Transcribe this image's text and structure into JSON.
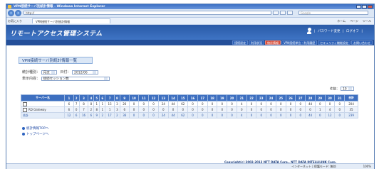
{
  "window": {
    "title": "VPN接続サーバ別統計情報 - Windows Internet Explorer"
  },
  "addressbar": {
    "url": "http://",
    "search_placeholder": "Google"
  },
  "favbar": {
    "favorites_label": "お気に入り",
    "tab_title": "VPN接続サーバ別統計情報",
    "tools": [
      "ホーム",
      "ページ",
      "ツール"
    ]
  },
  "banner": {
    "logo": "リモートアクセス管理システム",
    "links": [
      "パスワード変更",
      "ログオフ"
    ]
  },
  "nav": {
    "items": [
      "接続設定",
      "利用状況",
      "統計情報",
      "VPN接続単位・利用履歴",
      "セキュリティ機能設定",
      "お問い合わせ"
    ],
    "active_index": 2
  },
  "page": {
    "title": "VPN接続サーバ別統計情報一覧",
    "filters": [
      {
        "label": "統計種別：",
        "value": "月次",
        "extra_label": "日付：",
        "extra_value": "2012/06"
      },
      {
        "label": "表示内容：",
        "value": "接続セッション数"
      }
    ],
    "count_label": "件数：",
    "count_value": "10"
  },
  "table": {
    "headers": [
      "サーバー名",
      "1",
      "2",
      "3",
      "4",
      "5",
      "6",
      "7",
      "8",
      "9",
      "10",
      "11",
      "12",
      "13",
      "14",
      "15",
      "16",
      "17",
      "18",
      "19",
      "20",
      "21",
      "22",
      "23",
      "24",
      "25",
      "26",
      "27",
      "28",
      "29",
      "30",
      "31",
      "合計"
    ],
    "rows": [
      {
        "name": "",
        "checkbox": true,
        "values": [
          "6",
          "7",
          "8",
          "8",
          "1",
          "1",
          "15",
          "3",
          "26",
          "0",
          "0",
          "0",
          "24",
          "44",
          "62",
          "0",
          "0",
          "0",
          "0",
          "0",
          "4",
          "0",
          "0",
          "0",
          "0",
          "0",
          "0",
          "44",
          "0",
          "0",
          "0",
          "204"
        ]
      },
      {
        "name": "RD Gateway",
        "checkbox": true,
        "values": [
          "6",
          "0",
          "7",
          "2",
          "8",
          "1",
          "1",
          "3",
          "6",
          "0",
          "0",
          "0",
          "0",
          "0",
          "0",
          "0",
          "0",
          "0",
          "0",
          "0",
          "0",
          "0",
          "0",
          "0",
          "0",
          "0",
          "0",
          "0",
          "1",
          "4",
          "0",
          "35"
        ]
      },
      {
        "name": "合計",
        "checkbox": false,
        "values": [
          "12",
          "6",
          "16",
          "6",
          "9",
          "2",
          "17",
          "2",
          "36",
          "0",
          "0",
          "0",
          "24",
          "44",
          "62",
          "0",
          "0",
          "0",
          "0",
          "0",
          "4",
          "0",
          "0",
          "0",
          "0",
          "0",
          "0",
          "44",
          "0",
          "12",
          "0",
          "239"
        ]
      }
    ]
  },
  "links": [
    "統計情報TOPへ",
    "トップページへ"
  ],
  "footer": {
    "copyright": "Copyright(c) 2002-2012 NTT DATA Corp., NTT DATA INTELLILINK Corp."
  },
  "statusbar": {
    "zone": "インターネット | 保護モード: 無効",
    "zoom": "100%"
  }
}
